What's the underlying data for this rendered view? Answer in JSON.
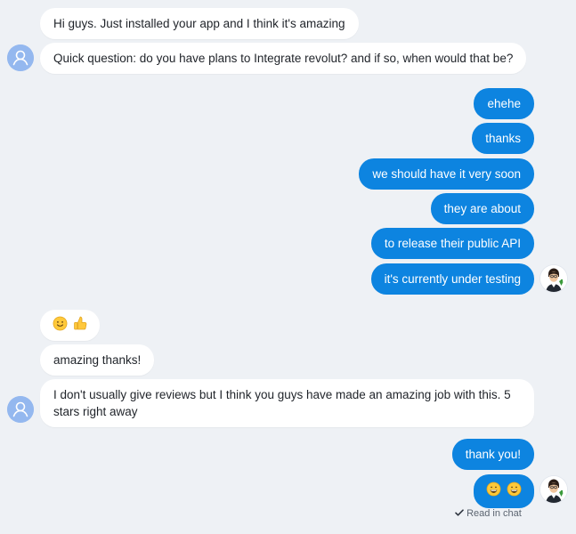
{
  "chat": {
    "messages": [
      {
        "id": "m1",
        "from": "user",
        "text": "Hi guys. Just installed your app and I think it's amazing"
      },
      {
        "id": "m2",
        "from": "user",
        "text": "Quick question: do you have plans to Integrate revolut? and if so, when would that be?"
      },
      {
        "id": "m3",
        "from": "agent",
        "text": "ehehe"
      },
      {
        "id": "m4",
        "from": "agent",
        "text": "thanks"
      },
      {
        "id": "m5",
        "from": "agent",
        "text": "we should have it very soon"
      },
      {
        "id": "m6",
        "from": "agent",
        "text": "they are about"
      },
      {
        "id": "m7",
        "from": "agent",
        "text": "to release their public API"
      },
      {
        "id": "m8",
        "from": "agent",
        "text": "it's currently under testing"
      },
      {
        "id": "m9",
        "from": "user",
        "emoji": [
          "slightly-smiling-face-emoji",
          "thumbs-up-emoji"
        ]
      },
      {
        "id": "m10",
        "from": "user",
        "text": "amazing thanks!"
      },
      {
        "id": "m11",
        "from": "user",
        "text": "I don't usually give reviews but I think you guys have made an amazing job with this. 5 stars right away"
      },
      {
        "id": "m12",
        "from": "agent",
        "text": "thank you!"
      },
      {
        "id": "m13",
        "from": "agent",
        "emoji": [
          "grinning-face-emoji",
          "grinning-face-emoji"
        ]
      }
    ],
    "read_receipt": {
      "icon": "checkmark-icon",
      "text": "Read in chat"
    },
    "colors": {
      "background": "#eef1f5",
      "incoming_bubble": "#ffffff",
      "outgoing_bubble": "#0d84e0",
      "user_avatar": "#94b8ef"
    }
  }
}
